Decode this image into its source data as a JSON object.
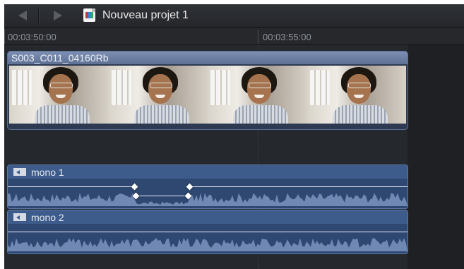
{
  "toolbar": {
    "back_icon": "chevron-left-icon",
    "forward_icon": "chevron-right-icon",
    "project_icon": "project-file-icon",
    "project_title": "Nouveau projet 1"
  },
  "ruler": {
    "timecodes": [
      "00:03:50:00",
      "00:03:55:00"
    ]
  },
  "video_clip": {
    "name": "S003_C011_04160Rb",
    "thumbnail_count": 4
  },
  "audio_clips": [
    {
      "label": "mono 1",
      "icon": "audio-clip-icon",
      "keyframes": 4
    },
    {
      "label": "mono 2",
      "icon": "audio-clip-icon",
      "keyframes": 0
    }
  ],
  "colors": {
    "video_clip_header": "#6e80a4",
    "audio_clip": "#2e4872",
    "waveform": "#6f88b4",
    "background": "#1b1d21"
  }
}
